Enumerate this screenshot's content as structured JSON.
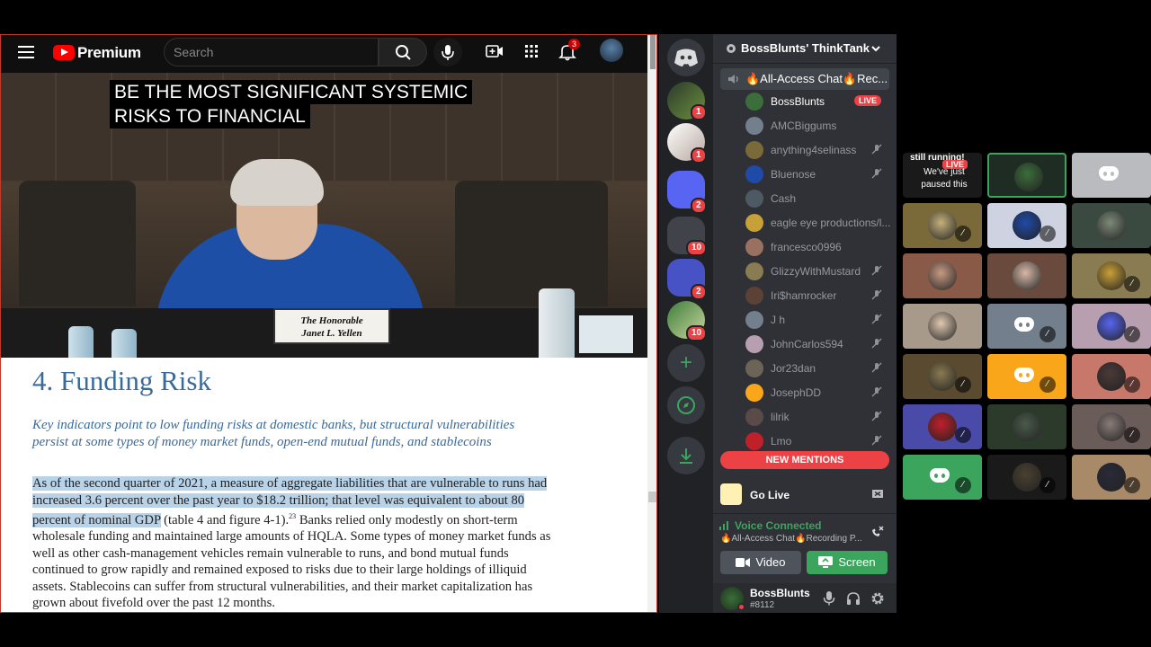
{
  "youtube": {
    "brand": "Premium",
    "search_placeholder": "Search",
    "notif_count": "3",
    "captions": [
      "BE THE MOST SIGNIFICANT SYSTEMIC",
      "RISKS TO FINANCIAL"
    ],
    "nameplate": [
      "The Honorable",
      "Janet L. Yellen"
    ]
  },
  "document": {
    "heading": "4.  Funding Risk",
    "key_points": "Key indicators point to low funding risks at domestic banks, but structural vulnerabilities persist at some types of money market funds, open-end mutual funds, and stablecoins",
    "body_highlighted": "As of the second quarter of 2021, a measure of aggregate liabilities that are vulnerable to runs had increased 3.6 percent over the past year to $18.2 trillion; that level was equivalent to about 80 percent of nominal GDP",
    "body_ref": " (table 4 and figure 4-1).",
    "body_sup": "23",
    "body_rest": " Banks relied only modestly on short-term wholesale funding and maintained large amounts of HQLA. Some types of money market funds as well as other cash-management vehicles remain vulnerable to runs, and bond mutual funds continued to grow rapidly and remained exposed to risks due to their large holdings of illiquid assets. Stablecoins can suffer from structural vulnerabilities, and their market capitalization has grown about fivefold over the past 12 months."
  },
  "discord": {
    "server_badges": [
      "1",
      "1",
      "2",
      "10",
      "2",
      "10"
    ],
    "guild_name": "BossBlunts' ThinkTank",
    "voice_channel": "🔥All-Access Chat🔥Rec...",
    "members": [
      {
        "name": "BossBlunts",
        "live": true,
        "live_label": "LIVE",
        "color": "#3b6e3a"
      },
      {
        "name": "AMCBiggums",
        "color": "#747f8d"
      },
      {
        "name": "anything4selinass",
        "muted": true,
        "color": "#7a6a3a"
      },
      {
        "name": "Bluenose",
        "muted": true,
        "color": "#1f4aa8"
      },
      {
        "name": "Cash",
        "color": "#4d5a63"
      },
      {
        "name": "eagle eye productions/l...",
        "color": "#c8a038"
      },
      {
        "name": "francesco0996",
        "color": "#9a7060"
      },
      {
        "name": "GlizzyWithMustard",
        "muted": true,
        "color": "#8a7c52"
      },
      {
        "name": "Iri$hamrocker",
        "muted": true,
        "color": "#5c4236"
      },
      {
        "name": "J h",
        "muted": true,
        "color": "#747f8d"
      },
      {
        "name": "JohnCarlos594",
        "muted": true,
        "color": "#b79fb0"
      },
      {
        "name": "Jor23dan",
        "muted": true,
        "color": "#6d6458"
      },
      {
        "name": "JosephDD",
        "muted": true,
        "color": "#faa61a"
      },
      {
        "name": "lilrik",
        "muted": true,
        "color": "#5a4a48"
      },
      {
        "name": "Lmo",
        "muted": true,
        "color": "#c0202a"
      }
    ],
    "new_mentions": "NEW MENTIONS",
    "go_live": "Go Live",
    "voice_connected": "Voice Connected",
    "voice_channel_full": "🔥All-Access Chat🔥Recording P...",
    "video_btn": "Video",
    "screen_btn": "Screen",
    "user_name": "BossBlunts",
    "user_tag": "#8112",
    "stream_tile_text": "still running!",
    "stream_tile_live": "LIVE",
    "stream_tile_caption": "We've just paused this"
  },
  "colors": {
    "blurple": "#5865f2",
    "green": "#3ba55d",
    "red": "#ed4245",
    "yellow": "#faa61a",
    "doc_blue": "#3a6a9a"
  }
}
